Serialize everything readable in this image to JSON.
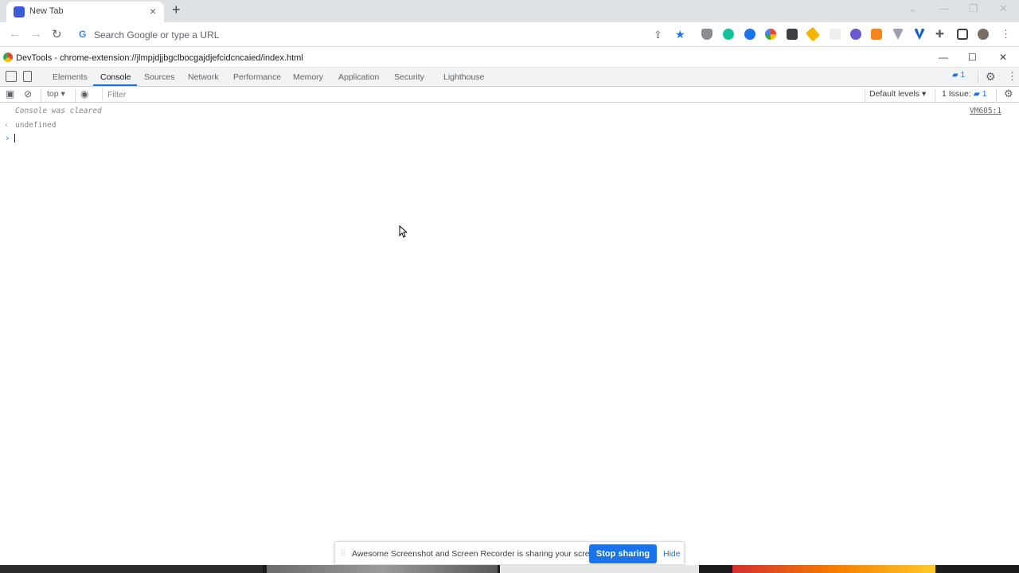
{
  "browser": {
    "tab_title": "New Tab",
    "omnibox_placeholder": "Search Google or type a URL"
  },
  "devtools": {
    "window_title": "DevTools - chrome-extension://jlmpjdjjbgclbocgajdjefcidcncaied/index.html",
    "tabs": [
      "Elements",
      "Console",
      "Sources",
      "Network",
      "Performance",
      "Memory",
      "Application",
      "Security",
      "Lighthouse"
    ],
    "active_tab": "Console",
    "message_badge": "1"
  },
  "console": {
    "context": "top",
    "filter_placeholder": "Filter",
    "levels_label": "Default levels",
    "issues_label": "1 Issue:",
    "issues_count": "1",
    "lines": {
      "cleared": "Console was cleared",
      "cleared_source": "VM605:1",
      "result": "undefined"
    }
  },
  "share_bar": {
    "message": "Awesome Screenshot and Screen Recorder is sharing your screen.",
    "stop_label": "Stop sharing",
    "hide_label": "Hide"
  },
  "colors": {
    "accent": "#1a73e8",
    "tabstrip": "#dee1e6",
    "devtools_toolbar": "#f1f3f4"
  }
}
